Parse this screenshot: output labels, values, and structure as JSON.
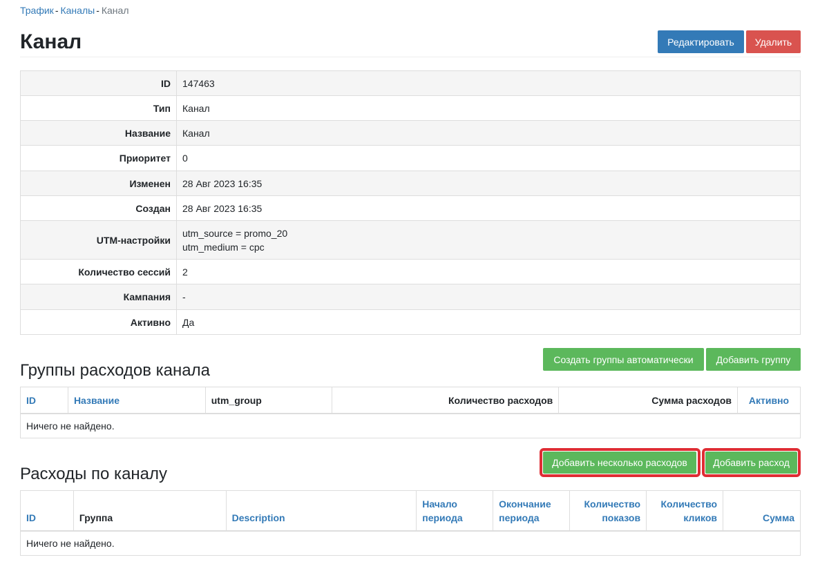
{
  "breadcrumb": {
    "items": [
      "Трафик",
      "Каналы"
    ],
    "sep": "-",
    "current": "Канал"
  },
  "page_title": "Канал",
  "actions": {
    "edit_label": "Редактировать",
    "delete_label": "Удалить"
  },
  "details": [
    {
      "label": "ID",
      "value": "147463"
    },
    {
      "label": "Тип",
      "value": "Канал"
    },
    {
      "label": "Название",
      "value": "Канал"
    },
    {
      "label": "Приоритет",
      "value": "0"
    },
    {
      "label": "Изменен",
      "value": "28 Авг 2023 16:35"
    },
    {
      "label": "Создан",
      "value": "28 Авг 2023 16:35"
    },
    {
      "label": "UTM-настройки",
      "value_lines": [
        "utm_source = promo_20",
        "utm_medium = cpc"
      ]
    },
    {
      "label": "Количество сессий",
      "value": "2"
    },
    {
      "label": "Кампания",
      "value": "-"
    },
    {
      "label": "Активно",
      "value": "Да"
    }
  ],
  "groups": {
    "title": "Группы расходов канала",
    "create_auto_label": "Создать группы автоматически",
    "add_group_label": "Добавить группу",
    "columns": [
      "ID",
      "Название",
      "utm_group",
      "Количество расходов",
      "Сумма расходов",
      "Активно"
    ],
    "empty_text": "Ничего не найдено."
  },
  "expenses": {
    "title": "Расходы по каналу",
    "add_many_label": "Добавить несколько расходов",
    "add_one_label": "Добавить расход",
    "columns": [
      {
        "lines": [
          "ID"
        ]
      },
      {
        "lines": [
          "Группа"
        ]
      },
      {
        "lines": [
          "Description"
        ]
      },
      {
        "lines": [
          "Начало",
          "периода"
        ]
      },
      {
        "lines": [
          "Окончание",
          "периода"
        ]
      },
      {
        "lines": [
          "Количество",
          "показов"
        ]
      },
      {
        "lines": [
          "Количество",
          "кликов"
        ]
      },
      {
        "lines": [
          "Сумма"
        ]
      }
    ],
    "empty_text": "Ничего не найдено."
  },
  "colors": {
    "link": "#337ab7",
    "primary": "#337ab7",
    "danger": "#d9534f",
    "success": "#5cb85c",
    "highlight": "#df2d34"
  }
}
